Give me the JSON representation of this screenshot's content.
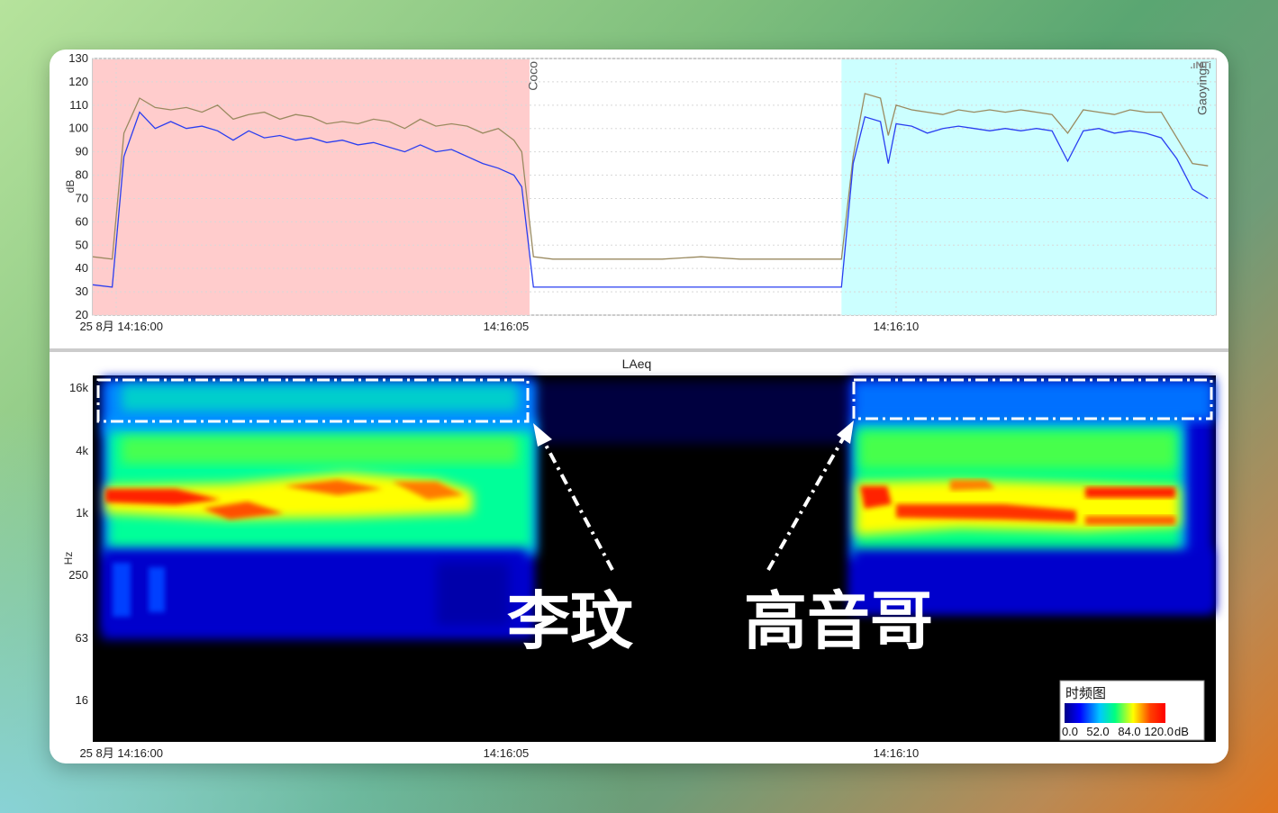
{
  "colors": {
    "speaker1_bg": "#ffcccc",
    "speaker2_bg": "#ccffff",
    "line_upper": "#9a8a60",
    "line_lower": "#2a3ef0",
    "spectrogram_bg": "#000000"
  },
  "top_chart": {
    "ylabel": "dB",
    "yticks": [
      "130",
      "120",
      "110",
      "100",
      "90",
      "80",
      "70",
      "60",
      "50",
      "40",
      "30",
      "20"
    ],
    "xticks": [
      "25 8月 14:16:00",
      "14:16:05",
      "14:16:10"
    ],
    "segment_labels": [
      "Coco",
      "Gaoyinge"
    ],
    "logo": ".ıNTi"
  },
  "bottom_chart": {
    "title": "LAeq",
    "ylabel": "Hz",
    "yticks": [
      "16k",
      "4k",
      "1k",
      "250",
      "63",
      "16"
    ],
    "xticks": [
      "25 8月 14:16:00",
      "14:16:05",
      "14:16:10"
    ],
    "legend": {
      "title": "时频图",
      "ticks": [
        "0.0",
        "52.0",
        "84.0",
        "120.0"
      ],
      "unit": "dB"
    }
  },
  "annotations": {
    "speaker1": "李玟",
    "speaker2": "高音哥"
  },
  "chart_data": [
    {
      "type": "line",
      "ylabel": "dB",
      "ylim": [
        20,
        130
      ],
      "xlim": [
        -0.3,
        14.1
      ],
      "x_unit": "seconds after 14:16:00",
      "regions": [
        {
          "label": "Coco",
          "x": [
            -0.3,
            5.3
          ],
          "color": "#ffcccc"
        },
        {
          "label": "Gaoyinge",
          "x": [
            9.3,
            14.1
          ],
          "color": "#ccffff"
        }
      ],
      "series": [
        {
          "color": "#9a8a60",
          "x": [
            -0.3,
            -0.05,
            0.1,
            0.3,
            0.5,
            0.7,
            0.9,
            1.1,
            1.3,
            1.5,
            1.7,
            1.9,
            2.1,
            2.3,
            2.5,
            2.7,
            2.9,
            3.1,
            3.3,
            3.5,
            3.7,
            3.9,
            4.1,
            4.3,
            4.5,
            4.7,
            4.9,
            5.1,
            5.2,
            5.35,
            5.6,
            6.0,
            6.5,
            7.0,
            7.5,
            8.0,
            8.5,
            9.0,
            9.3,
            9.45,
            9.6,
            9.8,
            9.9,
            10.0,
            10.2,
            10.4,
            10.6,
            10.8,
            11.0,
            11.2,
            11.4,
            11.6,
            11.8,
            12.0,
            12.2,
            12.4,
            12.6,
            12.8,
            13.0,
            13.2,
            13.4,
            13.6,
            13.8,
            14.0
          ],
          "y": [
            45,
            44,
            98,
            113,
            109,
            108,
            109,
            107,
            110,
            104,
            106,
            107,
            104,
            106,
            105,
            102,
            103,
            102,
            104,
            103,
            100,
            104,
            101,
            102,
            101,
            98,
            100,
            95,
            90,
            45,
            44,
            44,
            44,
            44,
            45,
            44,
            44,
            44,
            44,
            88,
            115,
            113,
            97,
            110,
            108,
            107,
            106,
            108,
            107,
            108,
            107,
            108,
            107,
            106,
            98,
            108,
            107,
            106,
            108,
            107,
            107,
            96,
            85,
            84
          ]
        },
        {
          "color": "#2a3ef0",
          "x": [
            -0.3,
            -0.05,
            0.1,
            0.3,
            0.5,
            0.7,
            0.9,
            1.1,
            1.3,
            1.5,
            1.7,
            1.9,
            2.1,
            2.3,
            2.5,
            2.7,
            2.9,
            3.1,
            3.3,
            3.5,
            3.7,
            3.9,
            4.1,
            4.3,
            4.5,
            4.7,
            4.9,
            5.1,
            5.2,
            5.35,
            5.6,
            6.0,
            6.5,
            7.0,
            7.5,
            8.0,
            8.5,
            9.0,
            9.3,
            9.45,
            9.6,
            9.8,
            9.9,
            10.0,
            10.2,
            10.4,
            10.6,
            10.8,
            11.0,
            11.2,
            11.4,
            11.6,
            11.8,
            12.0,
            12.2,
            12.4,
            12.6,
            12.8,
            13.0,
            13.2,
            13.4,
            13.6,
            13.8,
            14.0
          ],
          "y": [
            33,
            32,
            88,
            107,
            100,
            103,
            100,
            101,
            99,
            95,
            99,
            96,
            97,
            95,
            96,
            94,
            95,
            93,
            94,
            92,
            90,
            93,
            90,
            91,
            88,
            85,
            83,
            80,
            75,
            32,
            32,
            32,
            32,
            32,
            32,
            32,
            32,
            32,
            32,
            85,
            105,
            103,
            85,
            102,
            101,
            98,
            100,
            101,
            100,
            99,
            100,
            99,
            100,
            99,
            86,
            99,
            100,
            98,
            99,
            98,
            96,
            87,
            74,
            70
          ]
        }
      ]
    },
    {
      "type": "heatmap",
      "title": "LAeq",
      "ylabel": "Hz",
      "yticks": [
        "16k",
        "4k",
        "1k",
        "250",
        "63",
        "16"
      ],
      "colorbar": {
        "min": 0.0,
        "max": 120.0,
        "ticks": [
          0.0,
          52.0,
          84.0,
          120.0
        ],
        "unit": "dB"
      },
      "regions": [
        {
          "label": "李玟",
          "x": [
            -0.3,
            5.3
          ]
        },
        {
          "label": "高音哥",
          "x": [
            9.3,
            14.1
          ]
        }
      ]
    }
  ]
}
